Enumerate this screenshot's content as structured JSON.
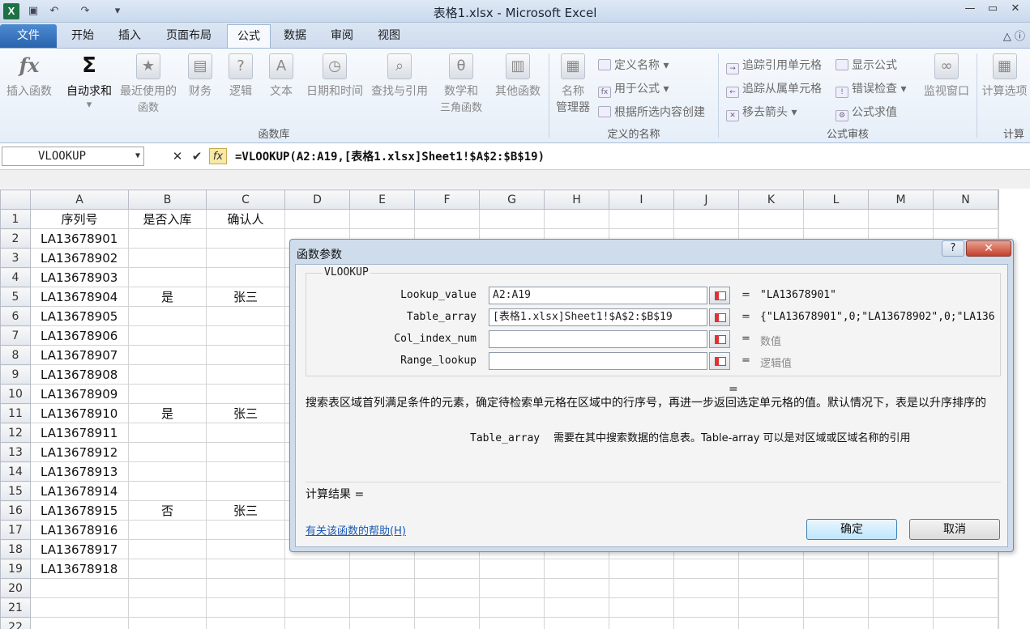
{
  "window": {
    "title": "表格1.xlsx - Microsoft Excel",
    "app_icon_letter": "X",
    "minimize": "—",
    "maximize": "▭",
    "close": "✕"
  },
  "ribbon_tabs": [
    "文件",
    "开始",
    "插入",
    "页面布局",
    "公式",
    "数据",
    "审阅",
    "视图"
  ],
  "ribbon": {
    "function_library": {
      "label": "函数库",
      "insert_function": "插入函数",
      "autosum": "自动求和",
      "recently_used_line1": "最近使用的",
      "recently_used_line2": "函数",
      "financial": "财务",
      "logical": "逻辑",
      "text": "文本",
      "datetime": "日期和时间",
      "lookup_reference": "查找与引用",
      "math_trig_line1": "数学和",
      "math_trig_line2": "三角函数",
      "more_functions": "其他函数"
    },
    "defined_names": {
      "label": "定义的名称",
      "name_manager_line1": "名称",
      "name_manager_line2": "管理器",
      "define_name": "定义名称",
      "use_in_formula": "用于公式",
      "create_from_selection": "根据所选内容创建"
    },
    "formula_auditing": {
      "label": "公式审核",
      "trace_precedents": "追踪引用单元格",
      "trace_dependents": "追踪从属单元格",
      "remove_arrows": "移去箭头",
      "show_formulas": "显示公式",
      "error_checking": "错误检查",
      "evaluate_formula": "公式求值",
      "watch_window": "监视窗口"
    },
    "calculation": {
      "label": "计算",
      "calc_options": "计算选项"
    }
  },
  "formula_bar": {
    "name_box": "VLOOKUP",
    "cancel": "✕",
    "enter": "✔",
    "fx": "fx",
    "formula": "=VLOOKUP(A2:A19,[表格1.xlsx]Sheet1!$A$2:$B$19)"
  },
  "sheet": {
    "columns": [
      "A",
      "B",
      "C",
      "D",
      "E",
      "F",
      "G",
      "H",
      "I",
      "J",
      "K",
      "L",
      "M",
      "N"
    ],
    "rows": [
      [
        "序列号",
        "是否入库",
        "确认人"
      ],
      [
        "LA13678901",
        "",
        ""
      ],
      [
        "LA13678902",
        "",
        ""
      ],
      [
        "LA13678903",
        "",
        ""
      ],
      [
        "LA13678904",
        "是",
        "张三"
      ],
      [
        "LA13678905",
        "",
        ""
      ],
      [
        "LA13678906",
        "",
        ""
      ],
      [
        "LA13678907",
        "",
        ""
      ],
      [
        "LA13678908",
        "",
        ""
      ],
      [
        "LA13678909",
        "",
        ""
      ],
      [
        "LA13678910",
        "是",
        "张三"
      ],
      [
        "LA13678911",
        "",
        ""
      ],
      [
        "LA13678912",
        "",
        ""
      ],
      [
        "LA13678913",
        "",
        ""
      ],
      [
        "LA13678914",
        "",
        ""
      ],
      [
        "LA13678915",
        "否",
        "张三"
      ],
      [
        "LA13678916",
        "",
        ""
      ],
      [
        "LA13678917",
        "",
        ""
      ],
      [
        "LA13678918",
        "",
        ""
      ],
      [
        "",
        "",
        ""
      ],
      [
        "",
        "",
        ""
      ],
      [
        "",
        "",
        ""
      ]
    ],
    "row_numbers": [
      "1",
      "2",
      "3",
      "4",
      "5",
      "6",
      "7",
      "8",
      "9",
      "10",
      "11",
      "12",
      "13",
      "14",
      "15",
      "16",
      "17",
      "18",
      "19",
      "20",
      "21",
      "22"
    ]
  },
  "dialog": {
    "title": "函数参数",
    "help": "?",
    "close": "✕",
    "function_name": "VLOOKUP",
    "args": [
      {
        "label": "Lookup_value",
        "value": "A2:A19",
        "result": "\"LA13678901\"",
        "hint": false
      },
      {
        "label": "Table_array",
        "value": "[表格1.xlsx]Sheet1!$A$2:$B$19",
        "result": "{\"LA13678901\",0;\"LA13678902\",0;\"LA136",
        "hint": false
      },
      {
        "label": "Col_index_num",
        "value": "",
        "result": "数值",
        "hint": true
      },
      {
        "label": "Range_lookup",
        "value": "",
        "result": "逻辑值",
        "hint": true
      }
    ],
    "equals": "=",
    "overall_result_eq": "=",
    "description": "搜索表区域首列满足条件的元素，确定待检索单元格在区域中的行序号，再进一步返回选定单元格的值。默认情况下，表是以升序排序的",
    "arg_help_name": "Table_array",
    "arg_help_text": "需要在其中搜索数据的信息表。Table-array 可以是对区域或区域名称的引用",
    "calc_result_label": "计算结果 =",
    "help_link": "有关该函数的帮助(H)",
    "ok": "确定",
    "cancel": "取消"
  }
}
